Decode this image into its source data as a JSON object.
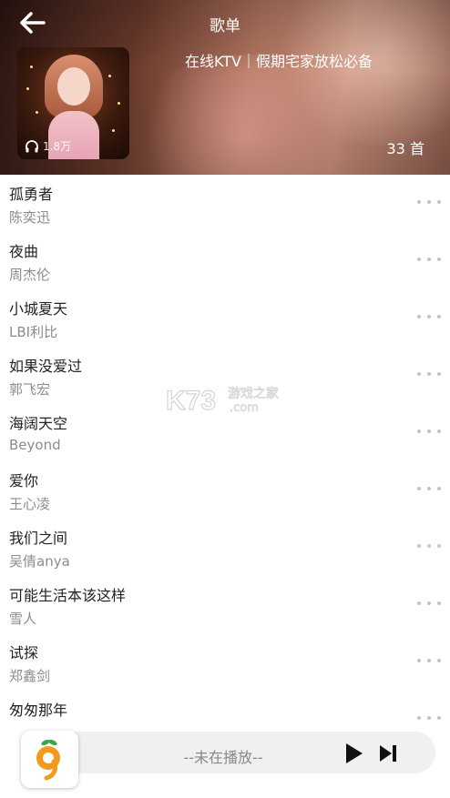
{
  "header": {
    "title": "歌单",
    "playlist_name": "在线KTV｜假期宅家放松必备",
    "play_count": "1.8万",
    "song_count": "33 首"
  },
  "songs": [
    {
      "title": "孤勇者",
      "artist": "陈奕迅"
    },
    {
      "title": "夜曲",
      "artist": "周杰伦"
    },
    {
      "title": "小城夏天",
      "artist": "LBI利比"
    },
    {
      "title": "如果没爱过",
      "artist": "郭飞宏"
    },
    {
      "title": "海阔天空",
      "artist": "Beyond"
    },
    {
      "title": "爱你",
      "artist": "王心凌"
    },
    {
      "title": "我们之间",
      "artist": "吴倩anya"
    },
    {
      "title": "可能生活本该这样",
      "artist": "雪人"
    },
    {
      "title": "试探",
      "artist": "郑鑫剑"
    },
    {
      "title": "匆匆那年",
      "artist": ""
    }
  ],
  "watermark": {
    "brand": "K73",
    "text1": "游戏之家",
    "text2": ".com"
  },
  "player": {
    "status": "--未在播放--"
  },
  "icons": {
    "back": "arrow-left-icon",
    "play_count": "headphone-icon",
    "more": "more-dots-icon",
    "play": "play-icon",
    "next": "next-icon",
    "logo": "app-logo-icon"
  },
  "colors": {
    "logo_orange": "#f39a1e",
    "logo_green": "#3aa84a"
  }
}
